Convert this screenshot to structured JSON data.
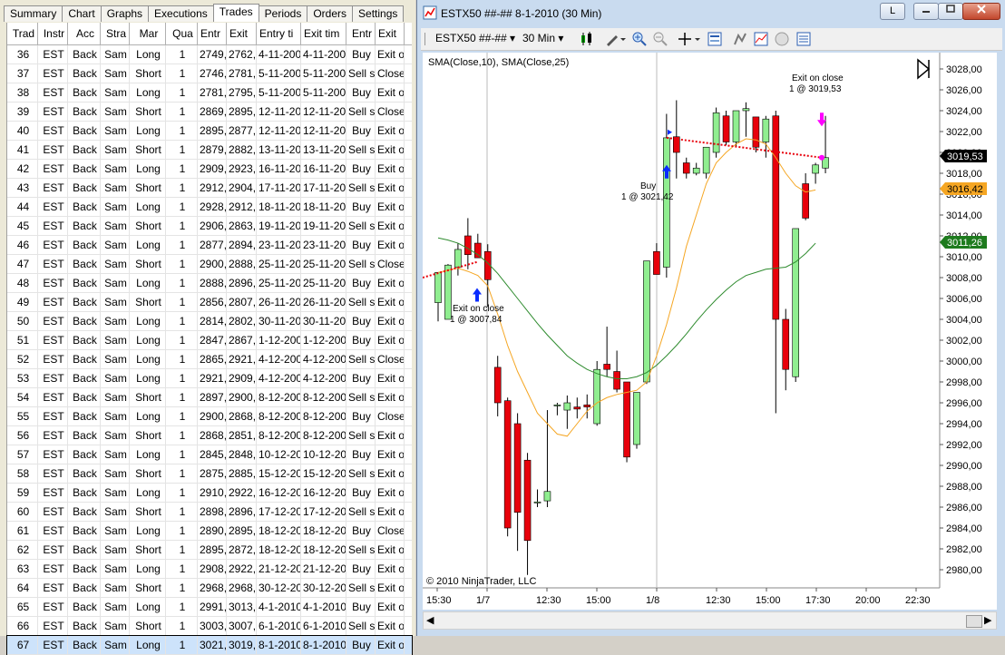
{
  "tabs": [
    "Summary",
    "Chart",
    "Graphs",
    "Executions",
    "Trades",
    "Periods",
    "Orders",
    "Settings"
  ],
  "active_tab": "Trades",
  "columns": [
    "Trad",
    "Instr",
    "Acc",
    "Stra",
    "Mar",
    "Qua",
    "Entr",
    "Exit",
    "Entry ti",
    "Exit tim",
    "Entr",
    "Exit"
  ],
  "rows": [
    [
      "36",
      "EST",
      "Back",
      "Sam",
      "Long",
      "1",
      "2749,",
      "2762,",
      "4-11-200",
      "4-11-200",
      "Buy",
      "Exit o"
    ],
    [
      "37",
      "EST",
      "Back",
      "Sam",
      "Short",
      "1",
      "2746,",
      "2781,",
      "5-11-200",
      "5-11-200",
      "Sell s",
      "Close"
    ],
    [
      "38",
      "EST",
      "Back",
      "Sam",
      "Long",
      "1",
      "2781,",
      "2795,",
      "5-11-200",
      "5-11-200",
      "Buy",
      "Exit o"
    ],
    [
      "39",
      "EST",
      "Back",
      "Sam",
      "Short",
      "1",
      "2869,",
      "2895,",
      "12-11-20",
      "12-11-20",
      "Sell s",
      "Close"
    ],
    [
      "40",
      "EST",
      "Back",
      "Sam",
      "Long",
      "1",
      "2895,",
      "2877,",
      "12-11-20",
      "12-11-20",
      "Buy",
      "Exit o"
    ],
    [
      "41",
      "EST",
      "Back",
      "Sam",
      "Short",
      "1",
      "2879,",
      "2882,",
      "13-11-20",
      "13-11-20",
      "Sell s",
      "Exit o"
    ],
    [
      "42",
      "EST",
      "Back",
      "Sam",
      "Long",
      "1",
      "2909,",
      "2923,",
      "16-11-20",
      "16-11-20",
      "Buy",
      "Exit o"
    ],
    [
      "43",
      "EST",
      "Back",
      "Sam",
      "Short",
      "1",
      "2912,",
      "2904,",
      "17-11-20",
      "17-11-20",
      "Sell s",
      "Exit o"
    ],
    [
      "44",
      "EST",
      "Back",
      "Sam",
      "Long",
      "1",
      "2928,",
      "2912,",
      "18-11-20",
      "18-11-20",
      "Buy",
      "Exit o"
    ],
    [
      "45",
      "EST",
      "Back",
      "Sam",
      "Short",
      "1",
      "2906,",
      "2863,",
      "19-11-20",
      "19-11-20",
      "Sell s",
      "Exit o"
    ],
    [
      "46",
      "EST",
      "Back",
      "Sam",
      "Long",
      "1",
      "2877,",
      "2894,",
      "23-11-20",
      "23-11-20",
      "Buy",
      "Exit o"
    ],
    [
      "47",
      "EST",
      "Back",
      "Sam",
      "Short",
      "1",
      "2900,",
      "2888,",
      "25-11-20",
      "25-11-20",
      "Sell s",
      "Close"
    ],
    [
      "48",
      "EST",
      "Back",
      "Sam",
      "Long",
      "1",
      "2888,",
      "2896,",
      "25-11-20",
      "25-11-20",
      "Buy",
      "Exit o"
    ],
    [
      "49",
      "EST",
      "Back",
      "Sam",
      "Short",
      "1",
      "2856,",
      "2807,",
      "26-11-20",
      "26-11-20",
      "Sell s",
      "Exit o"
    ],
    [
      "50",
      "EST",
      "Back",
      "Sam",
      "Long",
      "1",
      "2814,",
      "2802,",
      "30-11-20",
      "30-11-20",
      "Buy",
      "Exit o"
    ],
    [
      "51",
      "EST",
      "Back",
      "Sam",
      "Long",
      "1",
      "2847,",
      "2867,",
      "1-12-200",
      "1-12-200",
      "Buy",
      "Exit o"
    ],
    [
      "52",
      "EST",
      "Back",
      "Sam",
      "Long",
      "1",
      "2865,",
      "2921,",
      "4-12-200",
      "4-12-200",
      "Sell s",
      "Close"
    ],
    [
      "53",
      "EST",
      "Back",
      "Sam",
      "Long",
      "1",
      "2921,",
      "2909,",
      "4-12-200",
      "4-12-200",
      "Buy",
      "Exit o"
    ],
    [
      "54",
      "EST",
      "Back",
      "Sam",
      "Short",
      "1",
      "2897,",
      "2900,",
      "8-12-200",
      "8-12-200",
      "Sell s",
      "Exit o"
    ],
    [
      "55",
      "EST",
      "Back",
      "Sam",
      "Long",
      "1",
      "2900,",
      "2868,",
      "8-12-200",
      "8-12-200",
      "Buy",
      "Close"
    ],
    [
      "56",
      "EST",
      "Back",
      "Sam",
      "Short",
      "1",
      "2868,",
      "2851,",
      "8-12-200",
      "8-12-200",
      "Sell s",
      "Exit o"
    ],
    [
      "57",
      "EST",
      "Back",
      "Sam",
      "Long",
      "1",
      "2845,",
      "2848,",
      "10-12-20",
      "10-12-20",
      "Buy",
      "Exit o"
    ],
    [
      "58",
      "EST",
      "Back",
      "Sam",
      "Short",
      "1",
      "2875,",
      "2885,",
      "15-12-20",
      "15-12-20",
      "Sell s",
      "Exit o"
    ],
    [
      "59",
      "EST",
      "Back",
      "Sam",
      "Long",
      "1",
      "2910,",
      "2922,",
      "16-12-20",
      "16-12-20",
      "Buy",
      "Exit o"
    ],
    [
      "60",
      "EST",
      "Back",
      "Sam",
      "Short",
      "1",
      "2898,",
      "2896,",
      "17-12-20",
      "17-12-20",
      "Sell s",
      "Exit o"
    ],
    [
      "61",
      "EST",
      "Back",
      "Sam",
      "Long",
      "1",
      "2890,",
      "2895,",
      "18-12-20",
      "18-12-20",
      "Buy",
      "Close"
    ],
    [
      "62",
      "EST",
      "Back",
      "Sam",
      "Short",
      "1",
      "2895,",
      "2872,",
      "18-12-20",
      "18-12-20",
      "Sell s",
      "Exit o"
    ],
    [
      "63",
      "EST",
      "Back",
      "Sam",
      "Long",
      "1",
      "2908,",
      "2922,",
      "21-12-20",
      "21-12-20",
      "Buy",
      "Exit o"
    ],
    [
      "64",
      "EST",
      "Back",
      "Sam",
      "Short",
      "1",
      "2968,",
      "2968,",
      "30-12-20",
      "30-12-20",
      "Sell s",
      "Exit o"
    ],
    [
      "65",
      "EST",
      "Back",
      "Sam",
      "Long",
      "1",
      "2991,",
      "3013,",
      "4-1-2010",
      "4-1-2010",
      "Buy",
      "Exit o"
    ],
    [
      "66",
      "EST",
      "Back",
      "Sam",
      "Short",
      "1",
      "3003,",
      "3007,",
      "6-1-2010",
      "6-1-2010",
      "Sell s",
      "Exit o"
    ],
    [
      "67",
      "EST",
      "Back",
      "Sam",
      "Long",
      "1",
      "3021,",
      "3019,",
      "8-1-2010",
      "8-1-2010",
      "Buy",
      "Exit o"
    ]
  ],
  "selected_row": "67",
  "window": {
    "title": "ESTX50 ##-##  8-1-2010 (30 Min)",
    "btn_l": "L"
  },
  "toolbar": {
    "instrument": "ESTX50 ##-##",
    "interval": "30 Min"
  },
  "chart": {
    "indicator_label": "SMA(Close,10), SMA(Close,25)",
    "copyright": "© 2010 NinjaTrader, LLC",
    "y_ticks": [
      "3028,00",
      "3026,00",
      "3024,00",
      "3022,00",
      "3020,00",
      "3018,00",
      "3016,00",
      "3014,00",
      "3012,00",
      "3010,00",
      "3008,00",
      "3006,00",
      "3004,00",
      "3002,00",
      "3000,00",
      "2998,00",
      "2996,00",
      "2994,00",
      "2992,00",
      "2990,00",
      "2988,00",
      "2986,00",
      "2984,00",
      "2982,00",
      "2980,00"
    ],
    "x_ticks": [
      "15:30",
      "1/7",
      "12:30",
      "15:00",
      "1/8",
      "12:30",
      "15:00",
      "17:30",
      "20:00",
      "22:30"
    ],
    "price_flags": [
      {
        "label": "3019,53",
        "bg": "#000000",
        "fg": "#ffffff"
      },
      {
        "label": "3016,42",
        "bg": "#f5a623",
        "fg": "#000000"
      },
      {
        "label": "3011,26",
        "bg": "#1e7b1e",
        "fg": "#ffffff"
      }
    ],
    "annotations": [
      {
        "l1": "Exit on close",
        "l2": "1 @ 3007,84"
      },
      {
        "l1": "Buy",
        "l2": "1 @ 3021,42"
      },
      {
        "l1": "Exit on close",
        "l2": "1 @ 3019,53"
      }
    ],
    "colors": {
      "up": "#90ee90",
      "down": "#e8000b",
      "sma10": "#f5a623",
      "sma25": "#2e8b2e",
      "trade_line": "#e8000b"
    }
  }
}
